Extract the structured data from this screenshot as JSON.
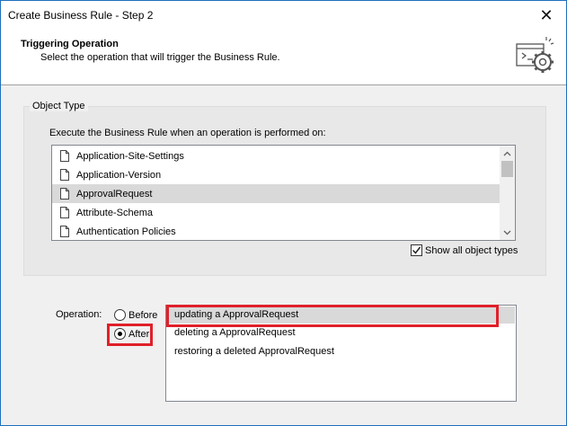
{
  "window": {
    "title": "Create Business Rule - Step 2",
    "close_glyph": "✕"
  },
  "header": {
    "title": "Triggering Operation",
    "subtitle": "Select the operation that will trigger the Business Rule.",
    "icon": "settings-wizard-icon"
  },
  "object_type": {
    "legend": "Object Type",
    "label": "Execute the Business Rule when an operation is performed on:",
    "items": [
      {
        "label": "Application-Site-Settings",
        "selected": false
      },
      {
        "label": "Application-Version",
        "selected": false
      },
      {
        "label": "ApprovalRequest",
        "selected": true
      },
      {
        "label": "Attribute-Schema",
        "selected": false
      },
      {
        "label": "Authentication Policies",
        "selected": false
      }
    ],
    "show_all_label": "Show all object types",
    "show_all_checked": true
  },
  "operation": {
    "label": "Operation:",
    "before_label": "Before",
    "after_label": "After",
    "selected": "After",
    "items": [
      {
        "label": "updating a ApprovalRequest",
        "selected": true
      },
      {
        "label": "deleting a ApprovalRequest",
        "selected": false
      },
      {
        "label": "restoring a deleted ApprovalRequest",
        "selected": false
      }
    ]
  },
  "colors": {
    "highlight_border": "#e0202a",
    "selection_bg": "#d9d9d9",
    "window_border": "#1e6fc0"
  }
}
